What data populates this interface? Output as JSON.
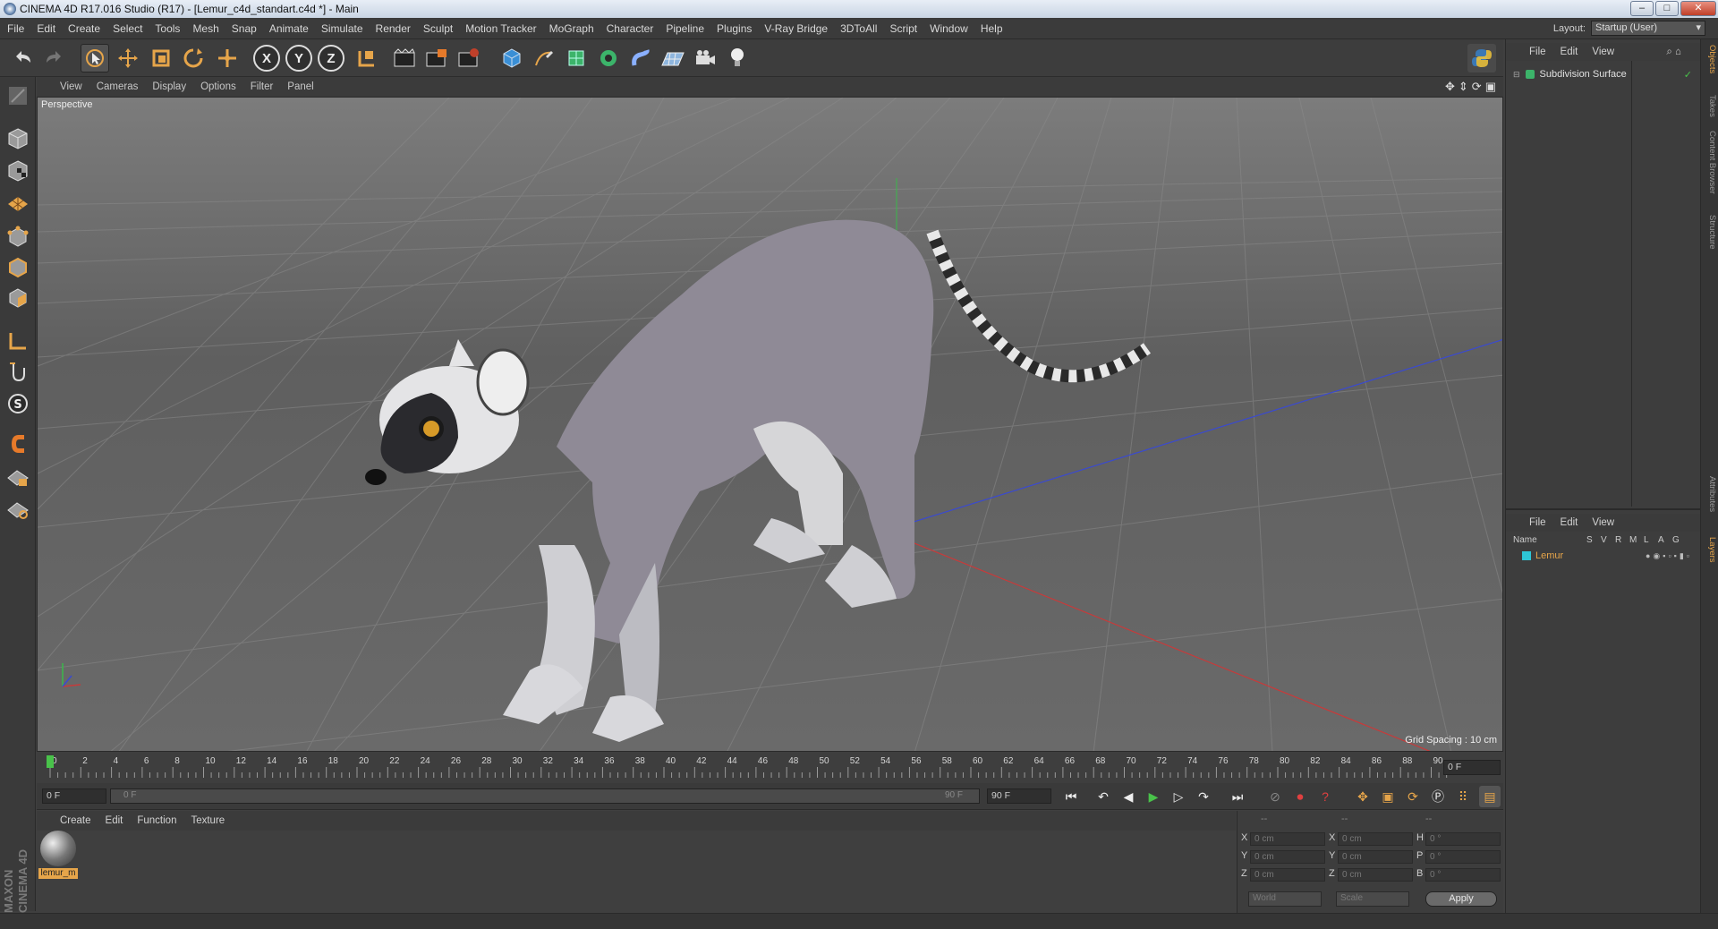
{
  "window": {
    "title": "CINEMA 4D R17.016 Studio (R17) - [Lemur_c4d_standart.c4d *] - Main",
    "buttons": {
      "minimize": "–",
      "maximize": "□",
      "close": "✕"
    }
  },
  "menubar": {
    "items": [
      "File",
      "Edit",
      "Create",
      "Select",
      "Tools",
      "Mesh",
      "Snap",
      "Animate",
      "Simulate",
      "Render",
      "Sculpt",
      "Motion Tracker",
      "MoGraph",
      "Character",
      "Pipeline",
      "Plugins",
      "V-Ray Bridge",
      "3DToAll",
      "Script",
      "Window",
      "Help"
    ],
    "layout_label": "Layout:",
    "layout_value": "Startup (User)"
  },
  "toolbar": {
    "axis_x": "X",
    "axis_y": "Y",
    "axis_z": "Z"
  },
  "viewport": {
    "menu": [
      "View",
      "Cameras",
      "Display",
      "Options",
      "Filter",
      "Panel"
    ],
    "camera_label": "Perspective",
    "grid_spacing": "Grid Spacing : 10 cm"
  },
  "timeline": {
    "ticks": [
      "0",
      "2",
      "4",
      "6",
      "8",
      "10",
      "12",
      "14",
      "16",
      "18",
      "20",
      "22",
      "24",
      "26",
      "28",
      "30",
      "32",
      "34",
      "36",
      "38",
      "40",
      "42",
      "44",
      "46",
      "48",
      "50",
      "52",
      "54",
      "56",
      "58",
      "60",
      "62",
      "64",
      "66",
      "68",
      "70",
      "72",
      "74",
      "76",
      "78",
      "80",
      "82",
      "84",
      "86",
      "88",
      "90"
    ],
    "current_frame": "0 F"
  },
  "transport": {
    "start_field": "0 F",
    "range_start": "0 F",
    "range_end": "90 F",
    "end_field": "90 F"
  },
  "materials": {
    "menu": [
      "Create",
      "Edit",
      "Function",
      "Texture"
    ],
    "items": [
      {
        "name": "lemur_m"
      }
    ]
  },
  "coordinates": {
    "header": [
      "--",
      "--",
      "--"
    ],
    "rows": [
      {
        "axis": "X",
        "pos": "0 cm",
        "axis2": "X",
        "size": "0 cm",
        "rot_label": "H",
        "rot": "0 °"
      },
      {
        "axis": "Y",
        "pos": "0 cm",
        "axis2": "Y",
        "size": "0 cm",
        "rot_label": "P",
        "rot": "0 °"
      },
      {
        "axis": "Z",
        "pos": "0 cm",
        "axis2": "Z",
        "size": "0 cm",
        "rot_label": "B",
        "rot": "0 °"
      }
    ],
    "mode_world": "World",
    "mode_scale": "Scale",
    "apply": "Apply"
  },
  "object_manager": {
    "menu": [
      "File",
      "Edit",
      "View"
    ],
    "objects": [
      {
        "name": "Subdivision Surface"
      }
    ]
  },
  "layer_manager": {
    "menu": [
      "File",
      "Edit",
      "View"
    ],
    "columns": {
      "name": "Name",
      "flags": [
        "S",
        "V",
        "R",
        "M",
        "L",
        "A",
        "G"
      ]
    },
    "layers": [
      {
        "name": "Lemur",
        "color": "#2ec6d6"
      }
    ]
  },
  "side_tabs": [
    "Objects",
    "Takes",
    "Content Browser",
    "Structure",
    "Attributes",
    "Layers"
  ],
  "branding": "MAXON CINEMA 4D",
  "colors": {
    "accent": "#e6a54a",
    "x_axis": "#c83a3a",
    "y_axis": "#3ab84a",
    "z_axis": "#3a4ad0",
    "play": "#49c24a"
  }
}
